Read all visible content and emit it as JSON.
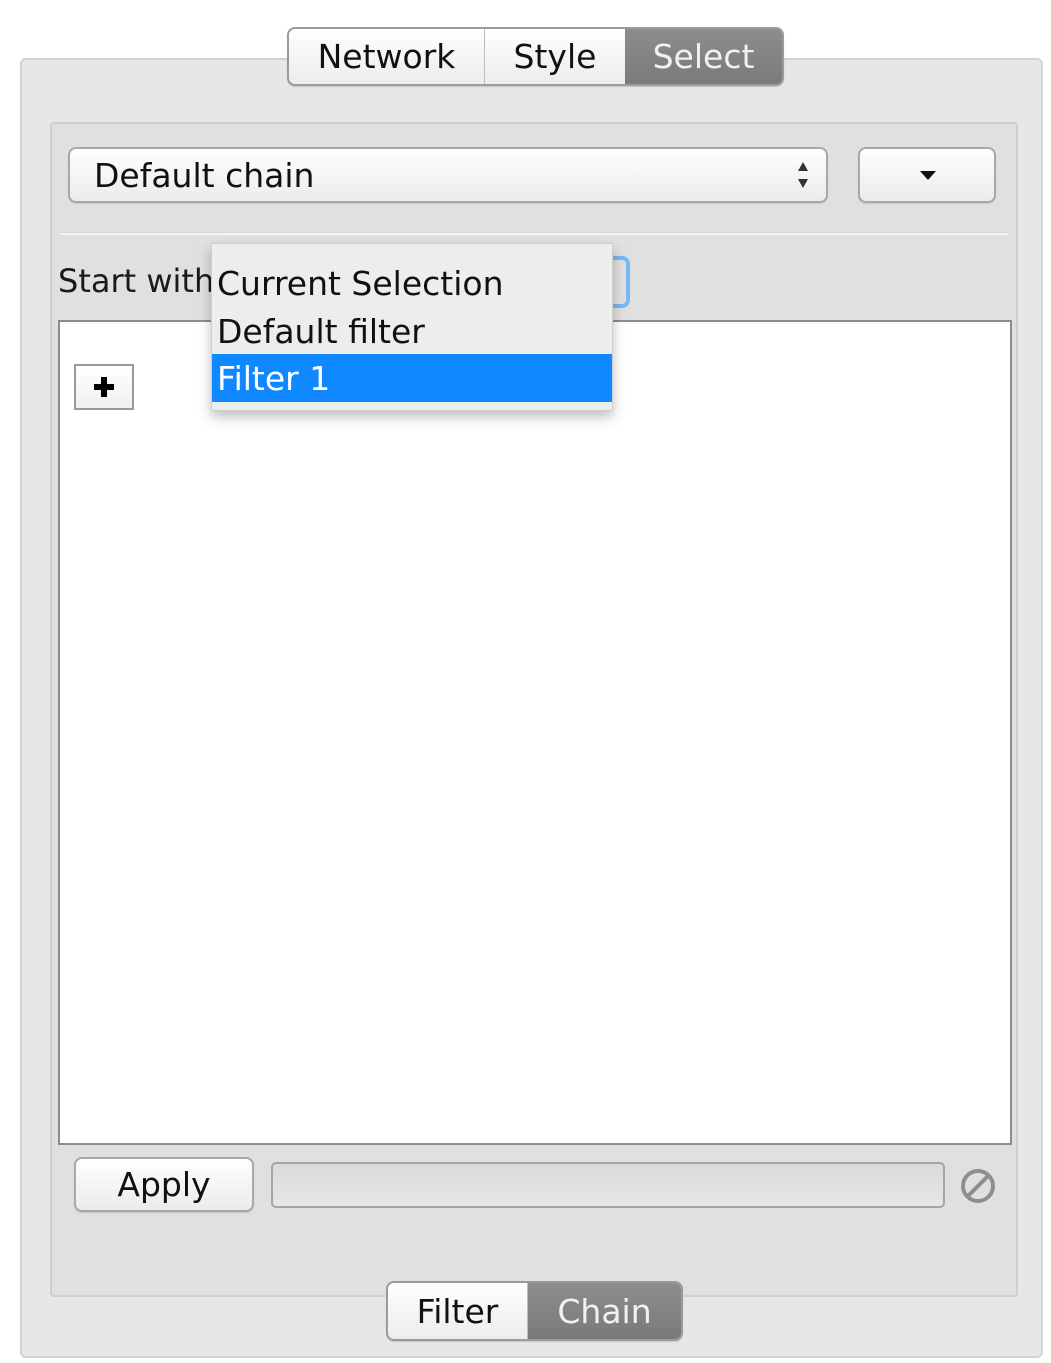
{
  "tabs": [
    {
      "label": "Network",
      "selected": false
    },
    {
      "label": "Style",
      "selected": false
    },
    {
      "label": "Select",
      "selected": true
    }
  ],
  "chain": {
    "selected": "Default chain"
  },
  "start_with": {
    "label": "Start with",
    "options": [
      "Current Selection",
      "Default filter",
      "Filter 1"
    ],
    "highlighted": "Filter 1"
  },
  "actions": {
    "add_icon": "plus-icon",
    "apply_label": "Apply",
    "cancel_icon": "cancel-icon"
  },
  "bottom_tabs": [
    {
      "label": "Filter",
      "selected": false
    },
    {
      "label": "Chain",
      "selected": true
    }
  ],
  "colors": {
    "highlight": "#1088ff",
    "selected_tab": "#858585",
    "focus_ring": "#78b8f2"
  }
}
